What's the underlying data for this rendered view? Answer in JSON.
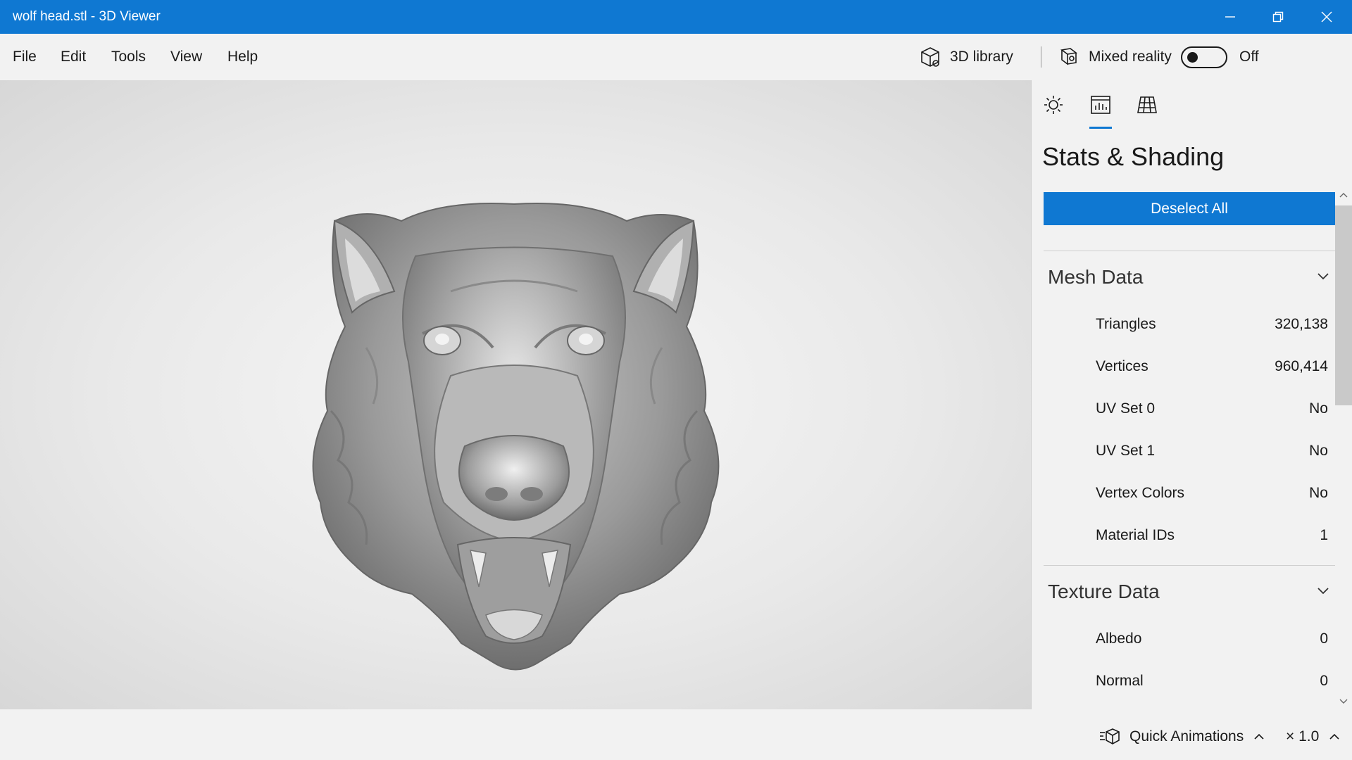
{
  "window": {
    "title": "wolf head.stl - 3D Viewer",
    "accent_color": "#0f78d2"
  },
  "menu": {
    "items": [
      "File",
      "Edit",
      "Tools",
      "View",
      "Help"
    ]
  },
  "toolbar": {
    "library_label": "3D library",
    "mixed_reality_label": "Mixed reality",
    "mixed_reality_state": "Off"
  },
  "panel": {
    "tabs": [
      "lighting-icon",
      "stats-icon",
      "grid-icon"
    ],
    "title": "Stats & Shading",
    "deselect_label": "Deselect All",
    "mesh": {
      "title": "Mesh Data",
      "rows": [
        {
          "label": "Triangles",
          "value": "320,138"
        },
        {
          "label": "Vertices",
          "value": "960,414"
        },
        {
          "label": "UV Set 0",
          "value": "No"
        },
        {
          "label": "UV Set 1",
          "value": "No"
        },
        {
          "label": "Vertex Colors",
          "value": "No"
        },
        {
          "label": "Material IDs",
          "value": "1"
        }
      ]
    },
    "texture": {
      "title": "Texture Data",
      "rows": [
        {
          "label": "Albedo",
          "value": "0"
        },
        {
          "label": "Normal",
          "value": "0"
        }
      ]
    }
  },
  "bottom": {
    "animations_label": "Quick Animations",
    "speed_label": "× 1.0"
  }
}
